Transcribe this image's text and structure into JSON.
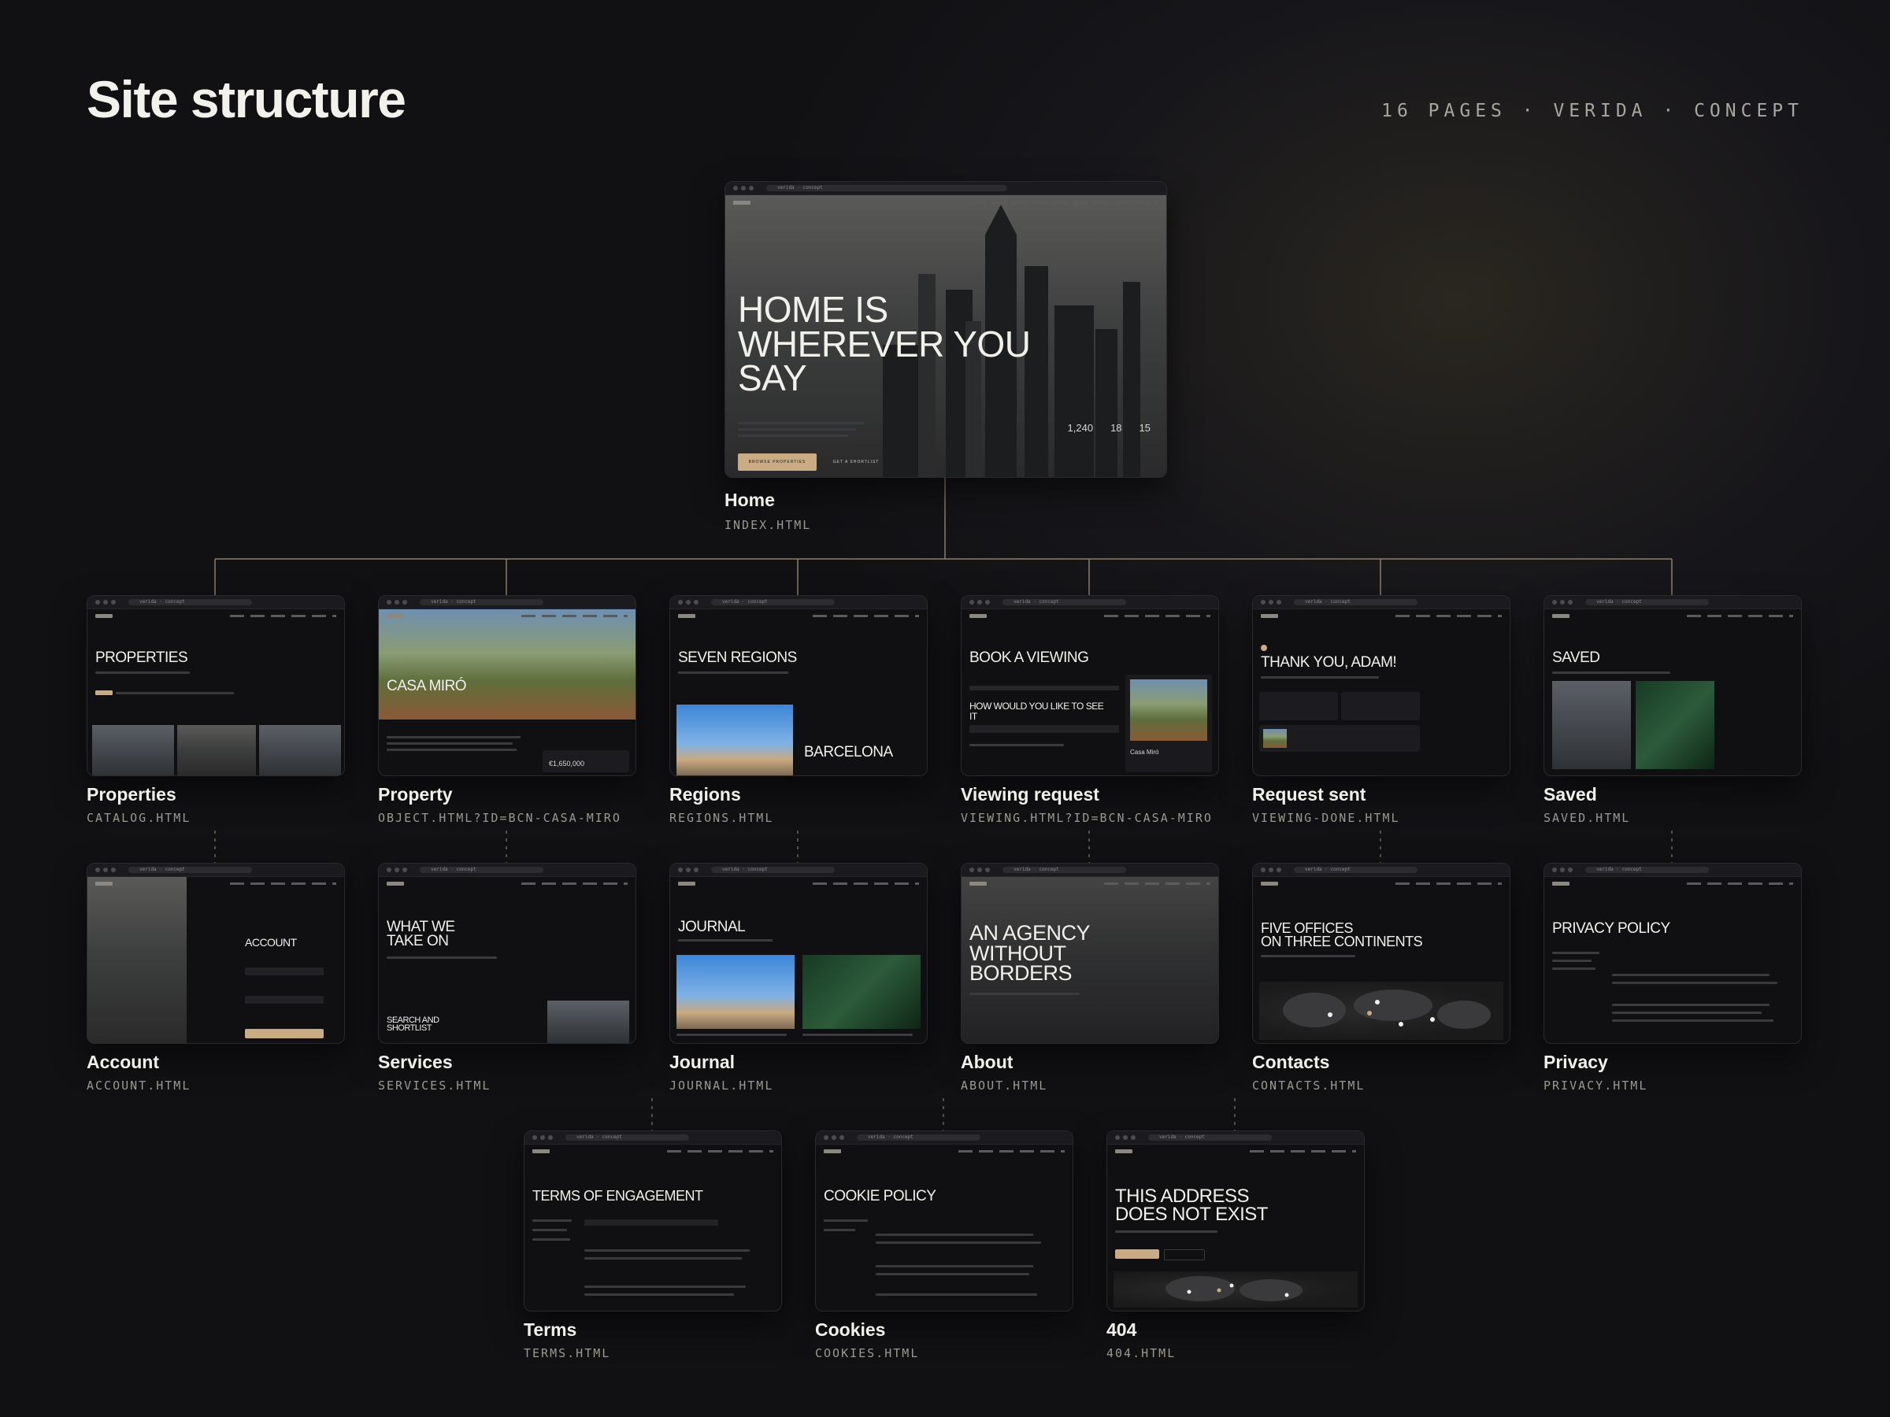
{
  "header": {
    "title": "Site structure",
    "meta": "16 PAGES · VERIDA · CONCEPT"
  },
  "browser": {
    "url": "verida · concept"
  },
  "home": {
    "label": "Home",
    "file": "INDEX.HTML",
    "brand": "VERIDA",
    "hero_title": "HOME IS\nWHEREVER YOU\nSAY",
    "stats": [
      "1,240",
      "18",
      "15"
    ],
    "primary_cta": "BROWSE PROPERTIES",
    "secondary_cta": "GET A SHORTLIST"
  },
  "pages": [
    {
      "label": "Properties",
      "file": "CATALOG.HTML",
      "heading": "PROPERTIES"
    },
    {
      "label": "Property",
      "file": "OBJECT.HTML?ID=BCN-CASA-MIRO",
      "heading": "CASA MIRÓ",
      "price": "€1,650,000"
    },
    {
      "label": "Regions",
      "file": "REGIONS.HTML",
      "heading": "SEVEN REGIONS",
      "region": "BARCELONA"
    },
    {
      "label": "Viewing request",
      "file": "VIEWING.HTML?ID=BCN-CASA-MIRO",
      "heading": "BOOK A VIEWING",
      "question": "HOW WOULD YOU LIKE TO SEE IT",
      "side_name": "Casa Miró"
    },
    {
      "label": "Request sent",
      "file": "VIEWING-DONE.HTML",
      "heading": "THANK YOU, ADAM!"
    },
    {
      "label": "Saved",
      "file": "SAVED.HTML",
      "heading": "SAVED"
    },
    {
      "label": "Account",
      "file": "ACCOUNT.HTML",
      "heading": "ACCOUNT"
    },
    {
      "label": "Services",
      "file": "SERVICES.HTML",
      "heading": "WHAT WE\nTAKE ON",
      "subheading": "SEARCH AND\nSHORTLIST"
    },
    {
      "label": "Journal",
      "file": "JOURNAL.HTML",
      "heading": "JOURNAL"
    },
    {
      "label": "About",
      "file": "ABOUT.HTML",
      "heading": "AN AGENCY\nWITHOUT\nBORDERS"
    },
    {
      "label": "Contacts",
      "file": "CONTACTS.HTML",
      "heading": "FIVE OFFICES\nON THREE CONTINENTS"
    },
    {
      "label": "Privacy",
      "file": "PRIVACY.HTML",
      "heading": "PRIVACY POLICY"
    },
    {
      "label": "Terms",
      "file": "TERMS.HTML",
      "heading": "TERMS OF ENGAGEMENT"
    },
    {
      "label": "Cookies",
      "file": "COOKIES.HTML",
      "heading": "COOKIE POLICY"
    },
    {
      "label": "404",
      "file": "404.HTML",
      "heading": "THIS ADDRESS\nDOES NOT EXIST"
    }
  ],
  "colors": {
    "accent": "#c9ab84",
    "background": "#141416",
    "connector": "#a08f74"
  }
}
